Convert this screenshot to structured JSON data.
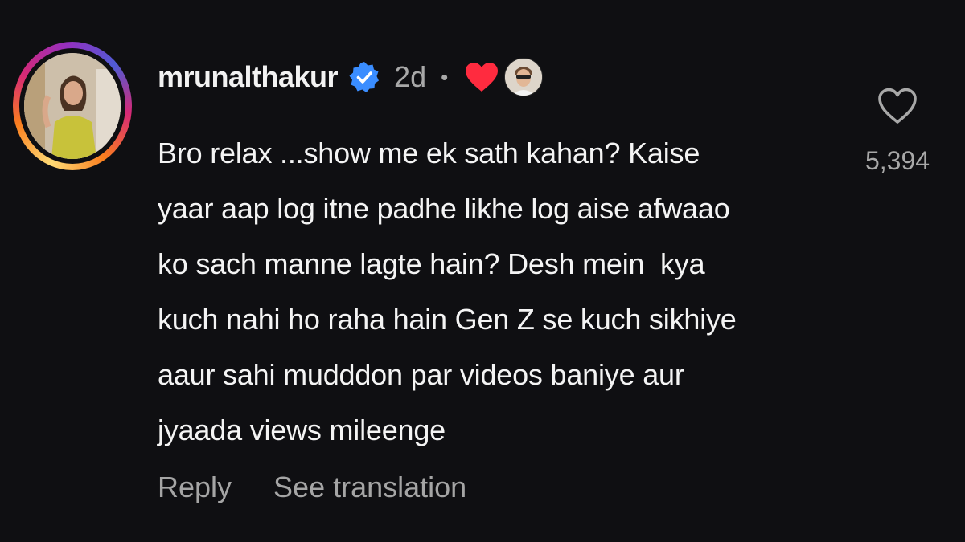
{
  "comment": {
    "username": "mrunalthakur",
    "verified": true,
    "time_ago": "2d",
    "separator": "•",
    "liked_by_creator": true,
    "text": "Bro relax ...show me ek sath kahan? Kaise\nyaar aap log itne padhe likhe log aise afwaao\nko sach manne lagte hain? Desh mein  kya\nkuch nahi ho raha hain Gen Z se kuch sikhiye\naaur sahi mudddon par videos baniye aur\njyaada views mileenge",
    "like_count": "5,394"
  },
  "actions": {
    "reply_label": "Reply",
    "translate_label": "See translation"
  },
  "icons": {
    "verified": "verified-badge-icon",
    "creator_heart": "heart-filled-icon",
    "like": "heart-outline-icon"
  },
  "colors": {
    "background": "#0f0f12",
    "verified_blue": "#3a8dff",
    "heart_red": "#ff2b3f",
    "muted_text": "#a8a8a8"
  }
}
